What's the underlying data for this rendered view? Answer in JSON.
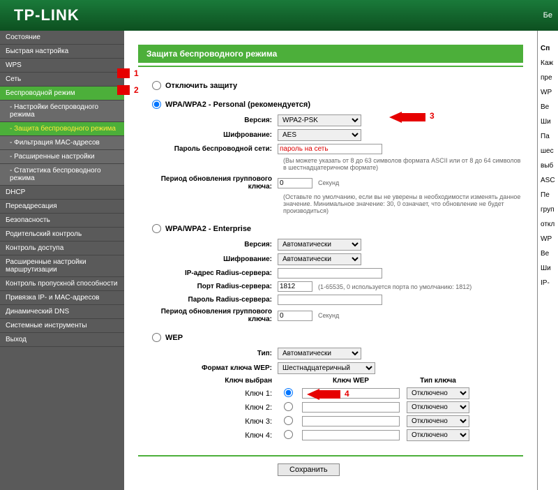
{
  "brand": "TP-LINK",
  "header_right": "Бе",
  "menu": [
    {
      "label": "Состояние",
      "sub": false
    },
    {
      "label": "Быстрая настройка",
      "sub": false
    },
    {
      "label": "WPS",
      "sub": false
    },
    {
      "label": "Сеть",
      "sub": false
    },
    {
      "label": "Беспроводной режим",
      "sub": false,
      "active": true
    },
    {
      "label": "- Настройки беспроводного режима",
      "sub": true
    },
    {
      "label": "- Защита беспроводного режима",
      "sub": true,
      "active": true
    },
    {
      "label": "- Фильтрация MAC-адресов",
      "sub": true
    },
    {
      "label": "- Расширенные настройки",
      "sub": true
    },
    {
      "label": "- Статистика беспроводного режима",
      "sub": true
    },
    {
      "label": "DHCP",
      "sub": false
    },
    {
      "label": "Переадресация",
      "sub": false
    },
    {
      "label": "Безопасность",
      "sub": false
    },
    {
      "label": "Родительский контроль",
      "sub": false
    },
    {
      "label": "Контроль доступа",
      "sub": false
    },
    {
      "label": "Расширенные настройки маршрутизации",
      "sub": false
    },
    {
      "label": "Контроль пропускной способности",
      "sub": false
    },
    {
      "label": "Привязка IP- и MAC-адресов",
      "sub": false
    },
    {
      "label": "Динамический DNS",
      "sub": false
    },
    {
      "label": "Системные инструменты",
      "sub": false
    },
    {
      "label": "Выход",
      "sub": false
    }
  ],
  "page_title": "Защита беспроводного режима",
  "disable_label": "Отключить защиту",
  "personal": {
    "title": "WPA/WPA2 - Personal (рекомендуется)",
    "version_label": "Версия:",
    "version_value": "WPA2-PSK",
    "encryption_label": "Шифрование:",
    "encryption_value": "AES",
    "password_label": "Пароль беспроводной сети:",
    "password_value": "пароль на сеть",
    "password_hint": "(Вы можете указать от 8 до 63 символов формата ASCII или от 8 до 64 символов в шестнадцатеричном формате)",
    "group_label": "Период обновления группового ключа:",
    "group_value": "0",
    "group_unit": "Секунд",
    "group_hint": "(Оставьте по умолчанию, если вы не уверены в необходимости изменять данное значение. Минимальное значение: 30, 0 означает, что обновление не будет производиться)"
  },
  "enterprise": {
    "title": "WPA/WPA2 - Enterprise",
    "version_label": "Версия:",
    "version_value": "Автоматически",
    "encryption_label": "Шифрование:",
    "encryption_value": "Автоматически",
    "radius_ip_label": "IP-адрес Radius-сервера:",
    "radius_ip_value": "",
    "radius_port_label": "Порт Radius-сервера:",
    "radius_port_value": "1812",
    "radius_port_hint": "(1-65535, 0 используется порта по умолчанию: 1812)",
    "radius_pwd_label": "Пароль Radius-сервера:",
    "radius_pwd_value": "",
    "group_label": "Период обновления группового ключа:",
    "group_value": "0",
    "group_unit": "Секунд"
  },
  "wep": {
    "title": "WEP",
    "type_label": "Тип:",
    "type_value": "Автоматически",
    "format_label": "Формат ключа WEP:",
    "format_value": "Шестнадцатеричный",
    "selected_label": "Ключ выбран",
    "wep_col": "Ключ WEP",
    "type_col": "Тип ключа",
    "keys": [
      {
        "label": "Ключ 1:",
        "value": "",
        "type": "Отключено"
      },
      {
        "label": "Ключ 2:",
        "value": "",
        "type": "Отключено"
      },
      {
        "label": "Ключ 3:",
        "value": "",
        "type": "Отключено"
      },
      {
        "label": "Ключ 4:",
        "value": "",
        "type": "Отключено"
      }
    ]
  },
  "save_label": "Сохранить",
  "markers": {
    "m1": "1",
    "m2": "2",
    "m3": "3",
    "m4": "4"
  },
  "right": [
    "Сп",
    "Каж",
    "пре",
    "WP",
    "Ве",
    "Ши",
    "Па",
    "шес",
    "выб",
    "ASC",
    "Пе",
    "груп",
    "откл",
    "WP",
    "Ве",
    "Ши",
    "IP-"
  ]
}
